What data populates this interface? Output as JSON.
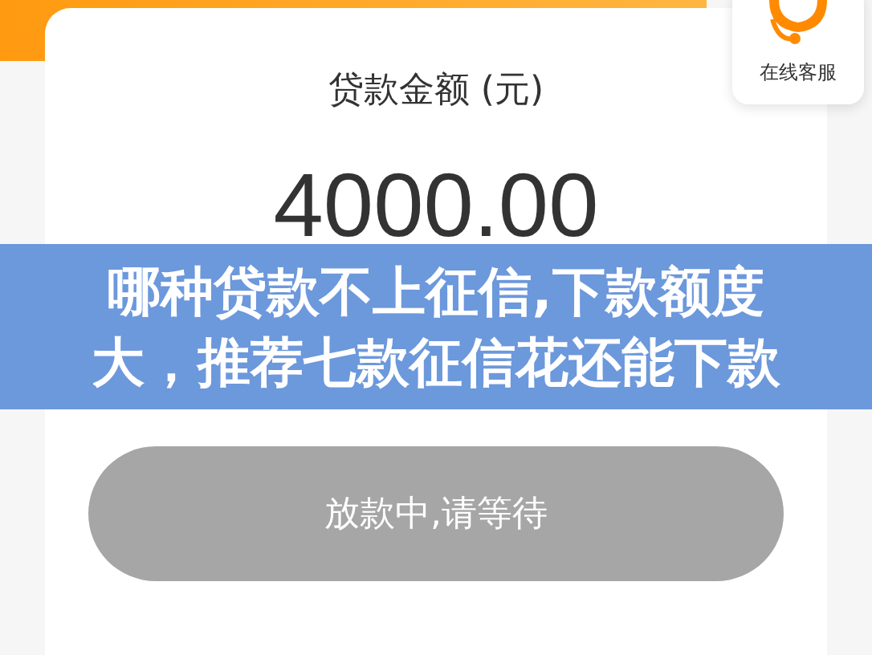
{
  "amount_card": {
    "label": "贷款金额 (元)",
    "amount": "4000.00"
  },
  "service_widget": {
    "label": "在线客服"
  },
  "banner": {
    "lines": [
      "哪种贷款不上征信,下款额度",
      "大，推荐七款征信花还能下款"
    ]
  },
  "submit_button": {
    "label": "放款中,请等待",
    "disabled": true
  }
}
